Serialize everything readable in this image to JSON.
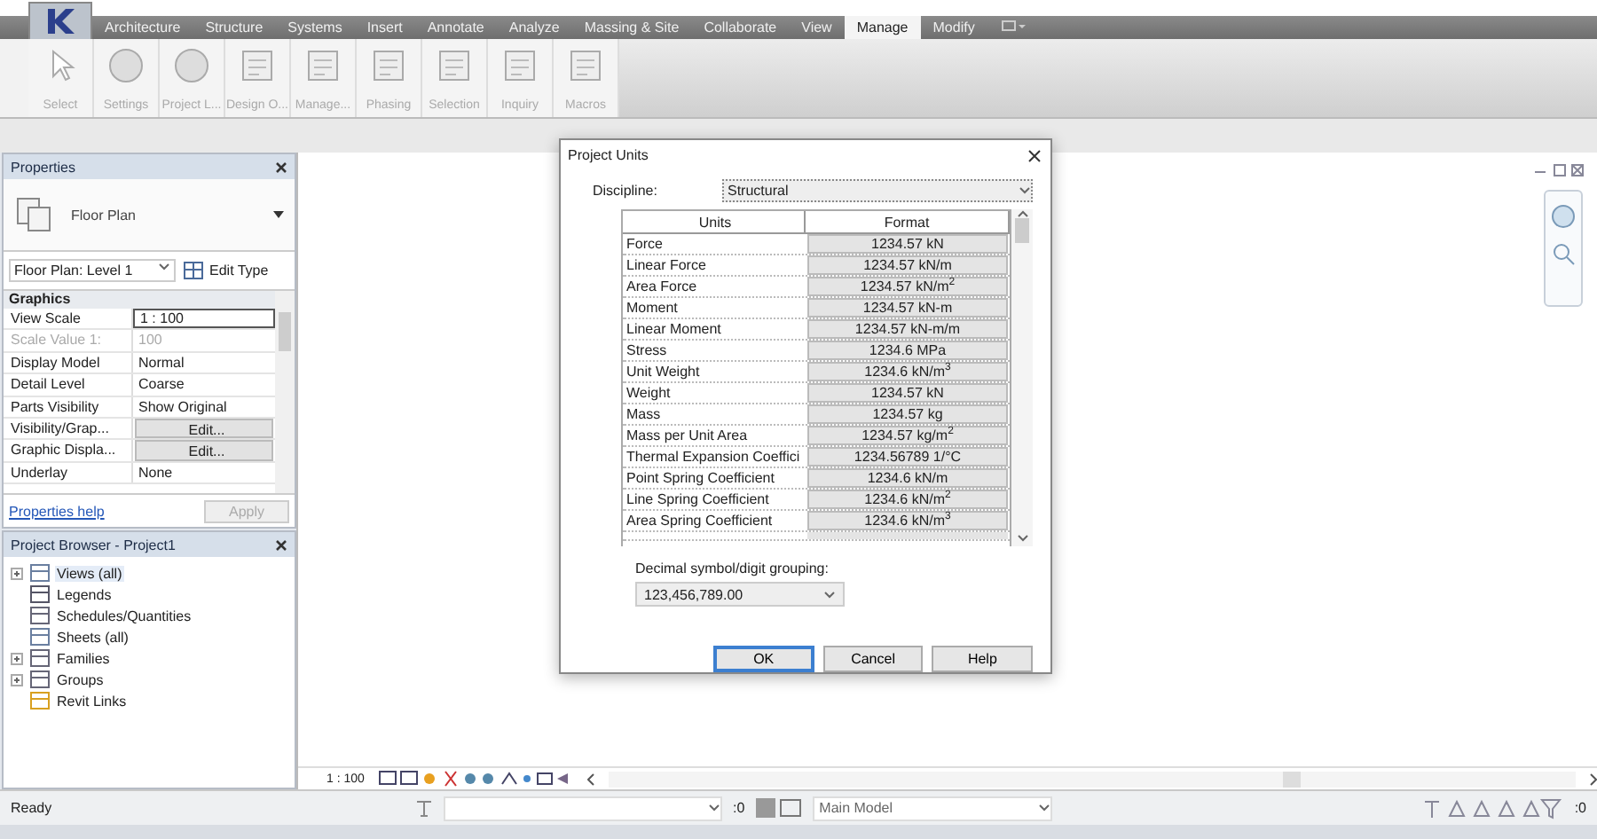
{
  "ribbon": {
    "tabs": [
      {
        "label": "Architecture",
        "selected": false
      },
      {
        "label": "Structure",
        "selected": false
      },
      {
        "label": "Systems",
        "selected": false
      },
      {
        "label": "Insert",
        "selected": false
      },
      {
        "label": "Annotate",
        "selected": false
      },
      {
        "label": "Analyze",
        "selected": false
      },
      {
        "label": "Massing & Site",
        "selected": false
      },
      {
        "label": "Collaborate",
        "selected": false
      },
      {
        "label": "View",
        "selected": false
      },
      {
        "label": "Manage",
        "selected": true
      },
      {
        "label": "Modify",
        "selected": false
      }
    ],
    "tools": [
      {
        "label": "Select"
      },
      {
        "label": "Settings"
      },
      {
        "label": "Project L..."
      },
      {
        "label": "Design O..."
      },
      {
        "label": "Manage..."
      },
      {
        "label": "Phasing"
      },
      {
        "label": "Selection"
      },
      {
        "label": "Inquiry"
      },
      {
        "label": "Macros"
      }
    ]
  },
  "properties": {
    "title": "Properties",
    "type_name": "Floor Plan",
    "instance": "Floor Plan: Level 1",
    "edit_type": "Edit Type",
    "group": "Graphics",
    "rows": [
      {
        "label": "View Scale",
        "value": "1 : 100",
        "kind": "field",
        "disabled": false
      },
      {
        "label": "Scale Value    1:",
        "value": "100",
        "kind": "text",
        "disabled": true
      },
      {
        "label": "Display Model",
        "value": "Normal",
        "kind": "text",
        "disabled": false
      },
      {
        "label": "Detail Level",
        "value": "Coarse",
        "kind": "text",
        "disabled": false
      },
      {
        "label": "Parts Visibility",
        "value": "Show Original",
        "kind": "text",
        "disabled": false
      },
      {
        "label": "Visibility/Grap...",
        "value": "Edit...",
        "kind": "button",
        "disabled": false
      },
      {
        "label": "Graphic Displa...",
        "value": "Edit...",
        "kind": "button",
        "disabled": false
      },
      {
        "label": "Underlay",
        "value": "None",
        "kind": "text",
        "disabled": false
      }
    ],
    "help": "Properties help",
    "apply": {
      "label": "Apply",
      "disabled": true
    }
  },
  "browser": {
    "title": "Project Browser - Project1",
    "items": [
      {
        "label": "Views (all)",
        "kind": "views",
        "expanded": false,
        "selected": true
      },
      {
        "label": "Legends",
        "kind": "legend",
        "selected": false
      },
      {
        "label": "Schedules/Quantities",
        "kind": "schedule",
        "selected": false
      },
      {
        "label": "Sheets (all)",
        "kind": "sheet",
        "selected": false
      },
      {
        "label": "Families",
        "kind": "family",
        "expanded": false,
        "selected": false
      },
      {
        "label": "Groups",
        "kind": "group",
        "expanded": false,
        "selected": false
      },
      {
        "label": "Revit Links",
        "kind": "link",
        "selected": false
      }
    ]
  },
  "view_bar": {
    "scale": "1 : 100"
  },
  "status_bar": {
    "message": "Ready",
    "count": ":0",
    "workset": "Main Model",
    "filter_count": ":0"
  },
  "dialog": {
    "title": "Project Units",
    "discipline_label": "Discipline:",
    "discipline": "Structural",
    "columns": [
      "Units",
      "Format"
    ],
    "rows": [
      {
        "units": "Force",
        "format": "1234.57 kN"
      },
      {
        "units": "Linear Force",
        "format": "1234.57 kN/m"
      },
      {
        "units": "Area Force",
        "format": "1234.57 kN/m$^{2}$"
      },
      {
        "units": "Moment",
        "format": "1234.57 kN-m"
      },
      {
        "units": "Linear Moment",
        "format": "1234.57 kN-m/m"
      },
      {
        "units": "Stress",
        "format": "1234.6 MPa"
      },
      {
        "units": "Unit Weight",
        "format": "1234.6 kN/m$^{3}$"
      },
      {
        "units": "Weight",
        "format": "1234.57 kN"
      },
      {
        "units": "Mass",
        "format": "1234.57 kg"
      },
      {
        "units": "Mass per Unit Area",
        "format": "1234.57 kg/m$^{2}$"
      },
      {
        "units": "Thermal Expansion Coeffici",
        "format": "1234.56789 1/°C"
      },
      {
        "units": "Point Spring Coefficient",
        "format": "1234.6 kN/m"
      },
      {
        "units": "Line Spring Coefficient",
        "format": "1234.6 kN/m$^{2}$"
      },
      {
        "units": "Area Spring Coefficient",
        "format": "1234.6 kN/m$^{3}$"
      }
    ],
    "grouping_label": "Decimal symbol/digit grouping:",
    "grouping": "123,456,789.00",
    "buttons": [
      {
        "label": "OK",
        "kind": "default"
      },
      {
        "label": "Cancel",
        "kind": "normal"
      },
      {
        "label": "Help",
        "kind": "normal"
      }
    ]
  }
}
